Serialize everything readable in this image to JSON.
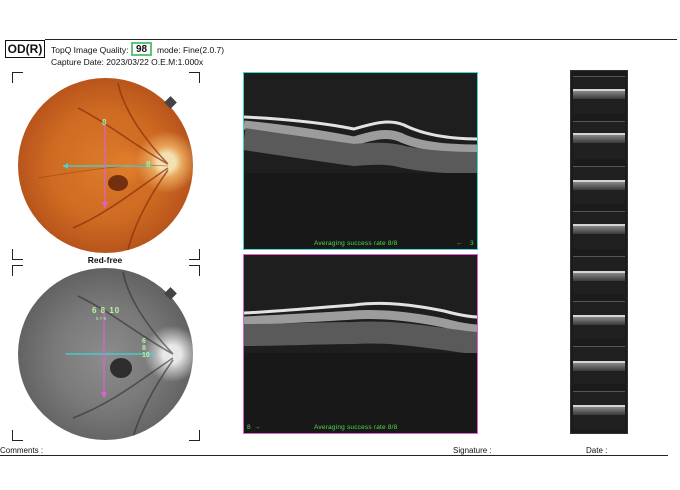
{
  "header": {
    "eye": "OD(R)",
    "quality_label": "TopQ Image Quality:",
    "quality_value": "98",
    "mode": "mode: Fine(2.0.7)",
    "capture": "Capture Date: 2023/03/22  O.E.M:1.000x"
  },
  "fundus": {
    "red_free_label": "Red-free",
    "color_vertical_number": "8",
    "color_horizontal_number": "8",
    "rf_numbers": "6 8 10",
    "rf_small_numbers": "5 7 9",
    "rf_side_numbers": "6 8 10"
  },
  "oct": {
    "top_rate": "Averaging success rate 8/8",
    "top_marker": "3",
    "bottom_rate": "Averaging success rate 8/8",
    "bottom_marker": "8"
  },
  "footer": {
    "comments": "Comments :",
    "signature": "Signature :",
    "date": "Date :"
  },
  "colors": {
    "quality_border": "#5ec47a",
    "scan_h": "#3fd6d6",
    "scan_v": "#e060d0",
    "green_text": "#4cd94c"
  }
}
